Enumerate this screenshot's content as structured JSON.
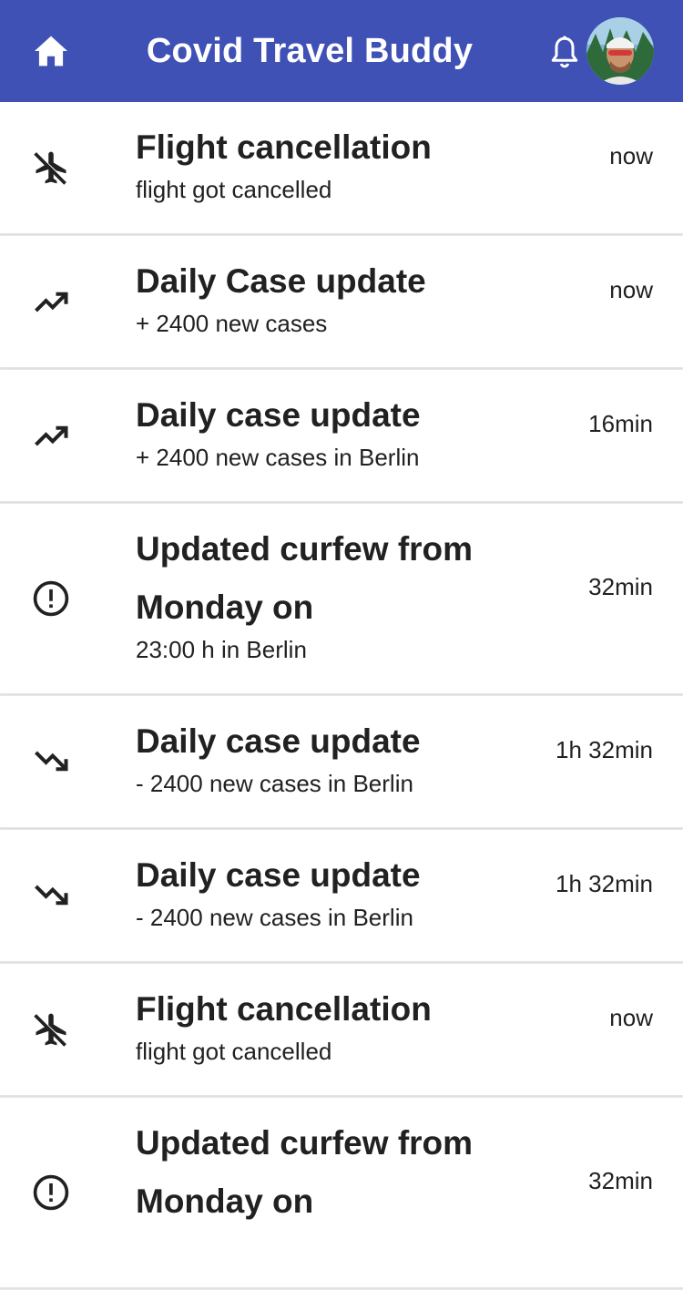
{
  "app": {
    "title": "Covid Travel Buddy",
    "header_color": "#3f51b5"
  },
  "notifications": [
    {
      "icon": "airplane-off-icon",
      "title": "Flight cancellation",
      "subtitle": "flight got cancelled",
      "time": "now"
    },
    {
      "icon": "trending-up-icon",
      "title": "Daily Case update",
      "subtitle": "+ 2400 new cases",
      "time": "now"
    },
    {
      "icon": "trending-up-icon",
      "title": "Daily case update",
      "subtitle": "+ 2400 new cases in Berlin",
      "time": "16min"
    },
    {
      "icon": "alert-circle-icon",
      "title": "Updated curfew from Monday on",
      "subtitle": "23:00 h in Berlin",
      "time": "32min"
    },
    {
      "icon": "trending-down-icon",
      "title": "Daily case update",
      "subtitle": "- 2400 new cases in Berlin",
      "time": "1h 32min"
    },
    {
      "icon": "trending-down-icon",
      "title": "Daily case update",
      "subtitle": "- 2400 new cases in Berlin",
      "time": "1h 32min"
    },
    {
      "icon": "airplane-off-icon",
      "title": "Flight cancellation",
      "subtitle": "flight got cancelled",
      "time": "now"
    },
    {
      "icon": "alert-circle-icon",
      "title": "Updated curfew from Monday on",
      "subtitle": "",
      "time": "32min"
    }
  ]
}
